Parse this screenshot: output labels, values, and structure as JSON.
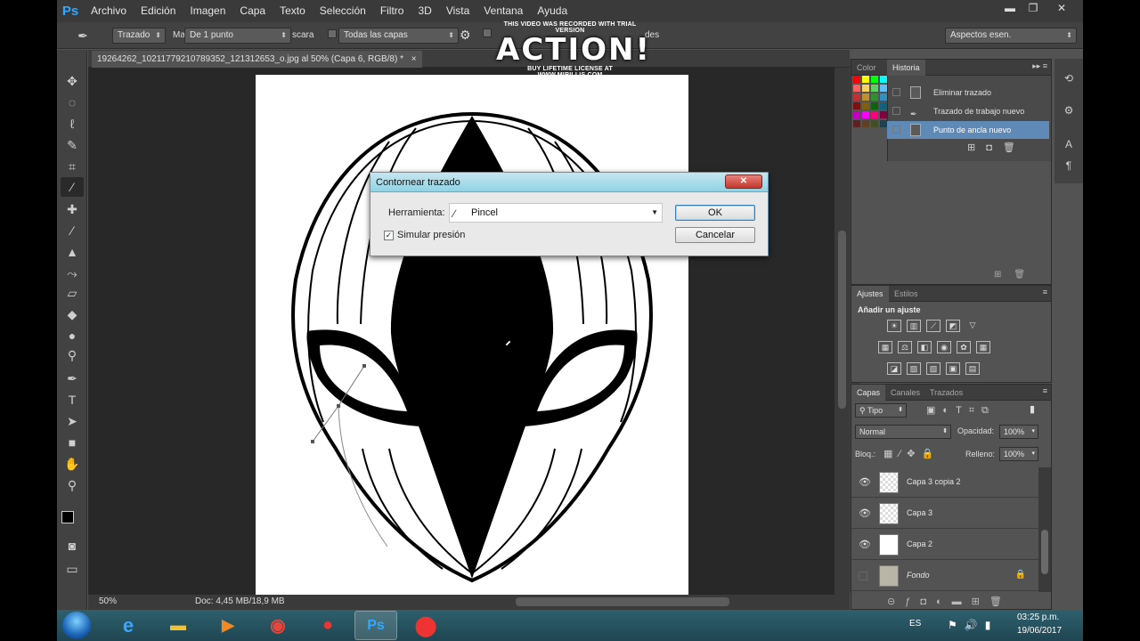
{
  "app": {
    "logo": "Ps"
  },
  "menu": [
    "Archivo",
    "Edición",
    "Imagen",
    "Capa",
    "Texto",
    "Selección",
    "Filtro",
    "3D",
    "Vista",
    "Ventana",
    "Ayuda"
  ],
  "window_controls": {
    "minimize": "▬",
    "restore": "❐",
    "close": "✕"
  },
  "options_bar": {
    "mode": "Trazado",
    "partial_label": "Ma",
    "brush_value": "De 1 punto",
    "mask_label": "scara",
    "sample_value": "Todas las capas",
    "hidden_text": "des",
    "workspace": "Aspectos esen."
  },
  "watermark": {
    "top": "THIS VIDEO WAS RECORDED WITH TRIAL VERSION",
    "brand": "ACTION!",
    "bottom": "BUY LIFETIME LICENSE AT WWW.MIRILLIS.COM"
  },
  "document": {
    "tab_title": "19264262_10211779210789352_121312653_o.jpg al 50% (Capa 6, RGB/8) *",
    "tab_close": "×",
    "zoom": "50%",
    "doc_size": "Doc: 4,45 MB/18,9 MB"
  },
  "dialog": {
    "title": "Contornear trazado",
    "tool_label": "Herramienta:",
    "tool_value": "Pincel",
    "simulate_label": "Simular presión",
    "simulate_checked": true,
    "ok": "OK",
    "cancel": "Cancelar",
    "close": "✕"
  },
  "color_panel": {
    "tabs": [
      "Color",
      "Historia"
    ],
    "swatches": [
      "#ff0000",
      "#ffff00",
      "#00ff00",
      "#00ffff",
      "#0000ff",
      "#ff6060",
      "#ffd060",
      "#60d060",
      "#60c0ff",
      "#8080ff",
      "#c03030",
      "#c09030",
      "#309030",
      "#3090c0",
      "#5050c0",
      "#801010",
      "#806010",
      "#106010",
      "#106080",
      "#303080",
      "#c000c0",
      "#ff00ff",
      "#ff0080",
      "#800040",
      "#c0c0c0",
      "#602020",
      "#604020",
      "#405020",
      "#204050",
      "#808080"
    ]
  },
  "history": {
    "items": [
      {
        "label": "Eliminar trazado",
        "selected": false
      },
      {
        "label": "Trazado de trabajo nuevo",
        "selected": false
      },
      {
        "label": "Punto de ancla nuevo",
        "selected": true
      }
    ]
  },
  "adjustments": {
    "tabs": [
      "Ajustes",
      "Estilos"
    ],
    "heading": "Añadir un ajuste"
  },
  "layers": {
    "tabs": [
      "Capas",
      "Canales",
      "Trazados"
    ],
    "filter": "Tipo",
    "blend_mode": "Normal",
    "opacity_label": "Opacidad:",
    "opacity": "100%",
    "lock_label": "Bloq.:",
    "fill_label": "Relleno:",
    "fill": "100%",
    "items": [
      {
        "name": "Capa 3 copia 2",
        "visible": true
      },
      {
        "name": "Capa 3",
        "visible": true
      },
      {
        "name": "Capa 2",
        "visible": true
      },
      {
        "name": "Fondo",
        "visible": false
      }
    ]
  },
  "taskbar": {
    "language": "ES",
    "time": "03:25 p.m.",
    "date": "19/06/2017",
    "ps_label": "Ps"
  },
  "colors": {
    "ps_blue": "#31a8ff",
    "history_selected": "#5f89b7"
  }
}
